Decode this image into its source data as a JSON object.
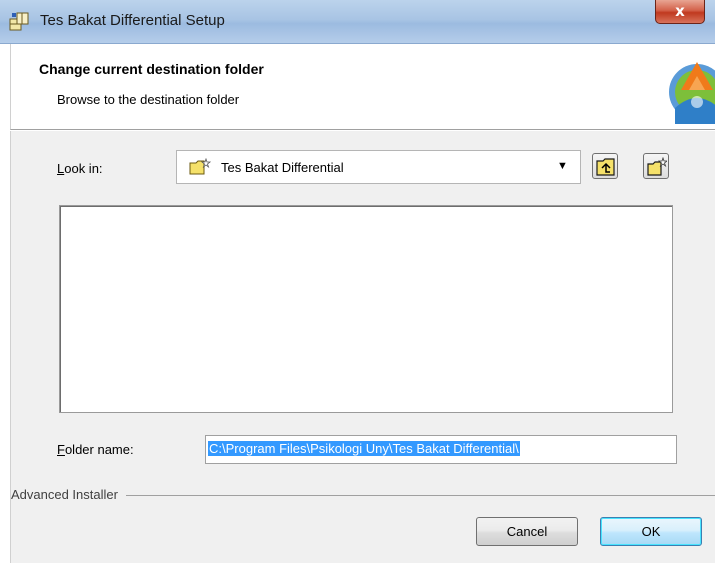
{
  "window": {
    "title": "Tes Bakat Differential Setup",
    "close_glyph": "x"
  },
  "header": {
    "title": "Change current destination folder",
    "subtitle": "Browse to the destination folder"
  },
  "look_in": {
    "label_accel": "L",
    "label_rest": "ook in:",
    "selected": "Tes Bakat Differential",
    "arrow": "▼"
  },
  "folder_name": {
    "label_accel": "F",
    "label_rest": "older name:",
    "value": "C:\\Program Files\\Psikologi Uny\\Tes Bakat Differential\\"
  },
  "footer": {
    "brand": "Advanced Installer",
    "cancel_label": "Cancel",
    "ok_label": "OK"
  },
  "icons": {
    "title": "setup-icon",
    "logo": "installer-logo-icon",
    "combo": "new-folder-icon",
    "up": "folder-up-icon",
    "new": "new-folder-icon"
  },
  "colors": {
    "selection": "#3399ff",
    "close": "#c0391f",
    "default_button_border": "#3c7fb1"
  }
}
